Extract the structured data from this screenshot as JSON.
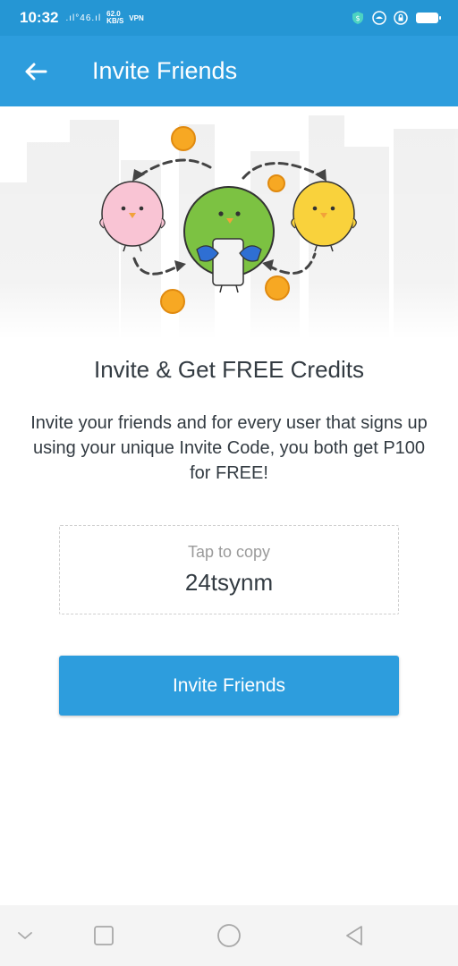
{
  "status_bar": {
    "time": "10:32",
    "signal": ".ıl°46.ıl",
    "speed_value": "62.0",
    "speed_unit": "KB/S",
    "vpn": "VPN"
  },
  "app_bar": {
    "title": "Invite Friends",
    "back_icon": "arrow-left-icon"
  },
  "content": {
    "headline": "Invite & Get FREE Credits",
    "description": "Invite your friends and for every user that signs up using your unique Invite Code, you both get P100 for FREE!",
    "code_box": {
      "hint": "Tap to copy",
      "code": "24tsynm"
    },
    "invite_button_label": "Invite Friends"
  },
  "nav_bar": {
    "items": [
      "chevron-down-icon",
      "square-icon",
      "circle-icon",
      "triangle-back-icon"
    ]
  },
  "colors": {
    "primary": "#2d9ddd",
    "status_bar": "#2596d4",
    "text": "#333b42",
    "coin": "#f7a823",
    "green_bird": "#7cc242",
    "pink_bird": "#f9c4d4",
    "yellow_bird": "#f9d23c"
  }
}
